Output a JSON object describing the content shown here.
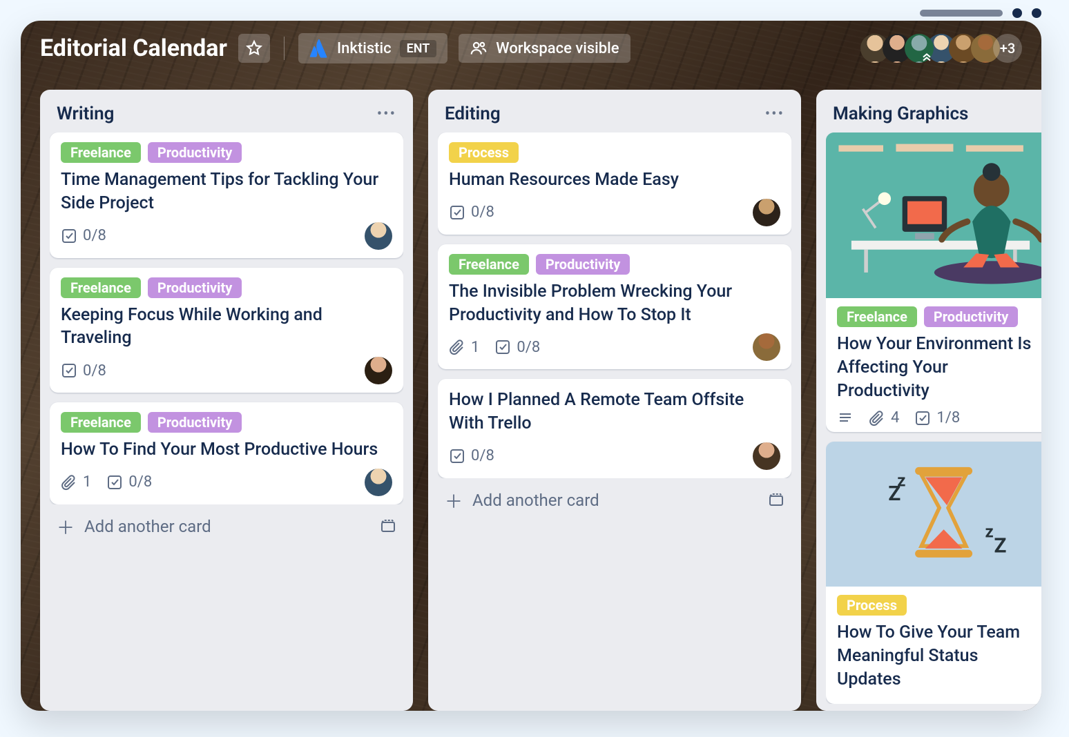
{
  "header": {
    "board_title": "Editorial Calendar",
    "workspace_name": "Inktistic",
    "workspace_badge": "ENT",
    "visibility_label": "Workspace visible",
    "members_more": "+3"
  },
  "label_text": {
    "freelance": "Freelance",
    "productivity": "Productivity",
    "process": "Process"
  },
  "lists": [
    {
      "title": "Writing",
      "add_label": "Add another card",
      "cards": [
        {
          "labels": [
            "freelance",
            "productivity"
          ],
          "title": "Time Management Tips for Tackling Your Side Project",
          "checklist": "0/8"
        },
        {
          "labels": [
            "freelance",
            "productivity"
          ],
          "title": "Keeping Focus While Working and Traveling",
          "checklist": "0/8"
        },
        {
          "labels": [
            "freelance",
            "productivity"
          ],
          "title": "How To Find Your Most Productive Hours",
          "attach": "1",
          "checklist": "0/8"
        }
      ]
    },
    {
      "title": "Editing",
      "add_label": "Add another card",
      "cards": [
        {
          "labels": [
            "process"
          ],
          "title": "Human Resources Made Easy",
          "checklist": "0/8"
        },
        {
          "labels": [
            "freelance",
            "productivity"
          ],
          "title": "The Invisible Problem Wrecking Your Productivity and How To Stop It",
          "attach": "1",
          "checklist": "0/8"
        },
        {
          "labels": [],
          "title": "How I Planned A Remote Team Offsite With Trello",
          "checklist": "0/8"
        }
      ]
    },
    {
      "title": "Making Graphics",
      "cards": [
        {
          "labels": [
            "freelance",
            "productivity"
          ],
          "title": "How Your Environment Is Affecting Your Productivity",
          "attach": "4",
          "checklist": "1/8",
          "has_desc": true
        },
        {
          "labels": [
            "process"
          ],
          "title": "How To Give Your Team Meaningful Status Updates"
        }
      ]
    }
  ]
}
